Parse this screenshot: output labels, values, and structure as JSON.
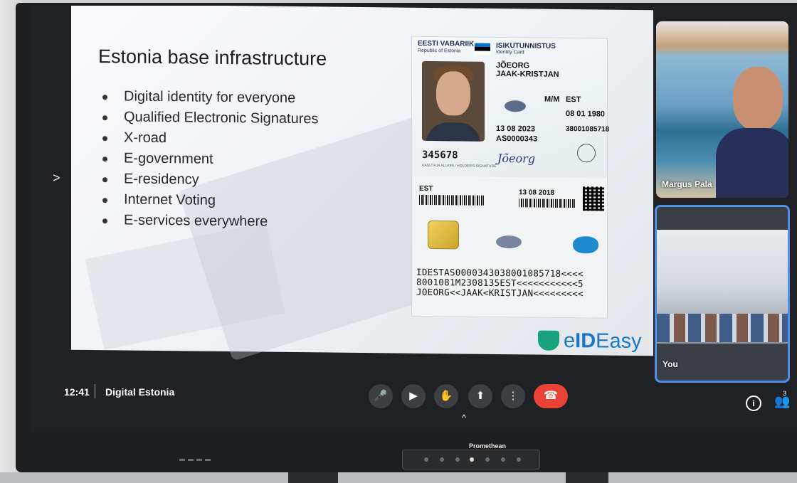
{
  "slide": {
    "title": "Estonia base infrastructure",
    "bullets": [
      "Digital identity for everyone",
      "Qualified Electronic Signatures",
      "X-road",
      "E-government",
      "E-residency",
      "Internet Voting",
      "E-services everywhere"
    ],
    "logo": {
      "e": "e",
      "id": "ID",
      "easy": "Easy"
    },
    "id_card": {
      "country": "EESTI VABARIIK",
      "country_en": "Republic of Estonia",
      "doc_title": "ISIKUTUNNISTUS",
      "doc_title_en": "Identity Card",
      "surname": "JÕEORG",
      "given_names": "JAAK-KRISTJAN",
      "sex": "M/M",
      "nationality": "EST",
      "birth_date": "08 01 1980",
      "expiry": "13 08 2023",
      "personal_code": "38001085718",
      "document_number": "AS0000343",
      "can": "345678",
      "signature": "Jõeorg",
      "signature_label": "KASUTAJA ALLKIRI / HOLDER'S SIGNATURE",
      "place_of_birth": "EST",
      "issue_date": "13 08 2018",
      "mrz": [
        "IDESTAS0000343038001085718<<<<",
        "8001081M2308135EST<<<<<<<<<<<5",
        "JOEORG<<JAAK<KRISTJAN<<<<<<<<<"
      ],
      "flag_colors": [
        "#0072ce",
        "#000000",
        "#ffffff"
      ]
    }
  },
  "participants": [
    {
      "name": "Margus Pala"
    },
    {
      "name": "You"
    }
  ],
  "meeting": {
    "time": "12:41",
    "name": "Digital Estonia",
    "controls": [
      {
        "icon": "microphone-icon",
        "glyph": "🎤"
      },
      {
        "icon": "camera-icon",
        "glyph": "▶"
      },
      {
        "icon": "raise-hand-icon",
        "glyph": "✋"
      },
      {
        "icon": "present-screen-icon",
        "glyph": "⬆"
      },
      {
        "icon": "more-options-icon",
        "glyph": "⋮"
      }
    ],
    "end_call_glyph": "☎",
    "info_glyph": "i",
    "people_glyph": "👥",
    "people_count": "3"
  },
  "device": {
    "brand": "Promethean"
  }
}
